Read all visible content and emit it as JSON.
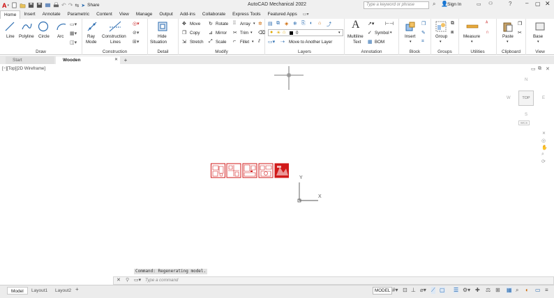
{
  "title_bar": {
    "app_title": "AutoCAD Mechanical 2022",
    "share_label": "Share",
    "search_placeholder": "Type a keyword or phrase",
    "sign_in": "Sign In"
  },
  "menu_tabs": [
    "Home",
    "Insert",
    "Annotate",
    "Parametric",
    "Content",
    "View",
    "Manage",
    "Output",
    "Add-ins",
    "Collaborate",
    "Express Tools",
    "Featured Apps"
  ],
  "ribbon": {
    "draw": {
      "label": "Draw",
      "line": "Line",
      "polyline": "Polyline",
      "circle": "Circle",
      "arc": "Arc"
    },
    "construction": {
      "label": "Construction",
      "ray": "Ray",
      "mode": "Mode",
      "construction": "Construction",
      "lines": "Lines"
    },
    "detail": {
      "label": "Detail",
      "hide": "Hide",
      "situation": "Situation"
    },
    "modify": {
      "label": "Modify",
      "move": "Move",
      "rotate": "Rotate",
      "array": "Array",
      "copy": "Copy",
      "mirror": "Mirror",
      "trim": "Trim",
      "stretch": "Stretch",
      "scale": "Scale",
      "fillet": "Fillet"
    },
    "layers": {
      "label": "Layers",
      "layer_value": "0",
      "move_layer": "Move to Another Layer"
    },
    "annotation": {
      "label": "Annotation",
      "multiline": "Multiline",
      "text": "Text",
      "symbol": "Symbol",
      "bom": "BOM"
    },
    "block": {
      "label": "Block",
      "insert": "Insert"
    },
    "groups": {
      "label": "Groups",
      "group": "Group"
    },
    "utilities": {
      "label": "Utilities",
      "measure": "Measure"
    },
    "clipboard": {
      "label": "Clipboard",
      "paste": "Paste"
    },
    "view": {
      "label": "View",
      "base": "Base"
    }
  },
  "doc_tabs": [
    "Start",
    "Wooden treehouse.dxf*"
  ],
  "canvas": {
    "view_label": "[−][Top][2D Wireframe]",
    "viewcube": {
      "top": "TOP",
      "n": "N",
      "s": "S",
      "e": "E",
      "w": "W",
      "wcs": "WCS"
    },
    "ucs": {
      "x": "X",
      "y": "Y"
    }
  },
  "command": {
    "history": "Command: Regenerating model.",
    "placeholder": "Type a command"
  },
  "layouts": [
    "Model",
    "Layout1",
    "Layout2"
  ],
  "status": {
    "model": "MODEL"
  },
  "colors": {
    "accent": "#2b6cb0",
    "drawing_red": "#d11a1a",
    "ribbon_bg": "#ffffff",
    "chrome": "#f0f0f0"
  }
}
